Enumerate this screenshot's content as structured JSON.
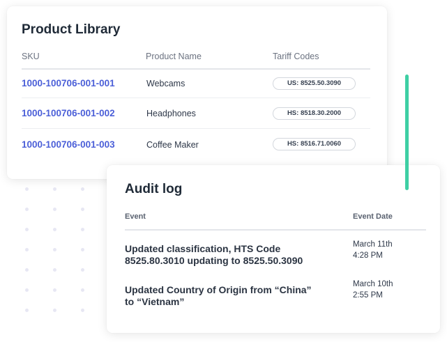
{
  "product_library": {
    "title": "Product Library",
    "columns": {
      "sku": "SKU",
      "name": "Product Name",
      "tariff": "Tariff Codes"
    },
    "rows": [
      {
        "sku": "1000-100706-001-001",
        "name": "Webcams",
        "tariff": "US: 8525.50.3090"
      },
      {
        "sku": "1000-100706-001-002",
        "name": "Headphones",
        "tariff": "HS: 8518.30.2000"
      },
      {
        "sku": "1000-100706-001-003",
        "name": "Coffee Maker",
        "tariff": "HS: 8516.71.0060"
      }
    ]
  },
  "audit_log": {
    "title": "Audit log",
    "columns": {
      "event": "Event",
      "date": "Event Date"
    },
    "entries": [
      {
        "event_line1": "Updated classification, HTS Code",
        "event_line2": "8525.80.3010 updating to 8525.50.3090",
        "date_line1": "March 11th",
        "date_line2": "4:28 PM"
      },
      {
        "event_line1": "Updated Country of Origin from “China”",
        "event_line2": "to “Vietnam”",
        "date_line1": "March 10th",
        "date_line2": "2:55 PM"
      }
    ]
  },
  "colors": {
    "sku_link": "#4b5fd8",
    "scrollbar_accent": "#3ecfa4",
    "dot_pattern": "#e7e7f3"
  }
}
